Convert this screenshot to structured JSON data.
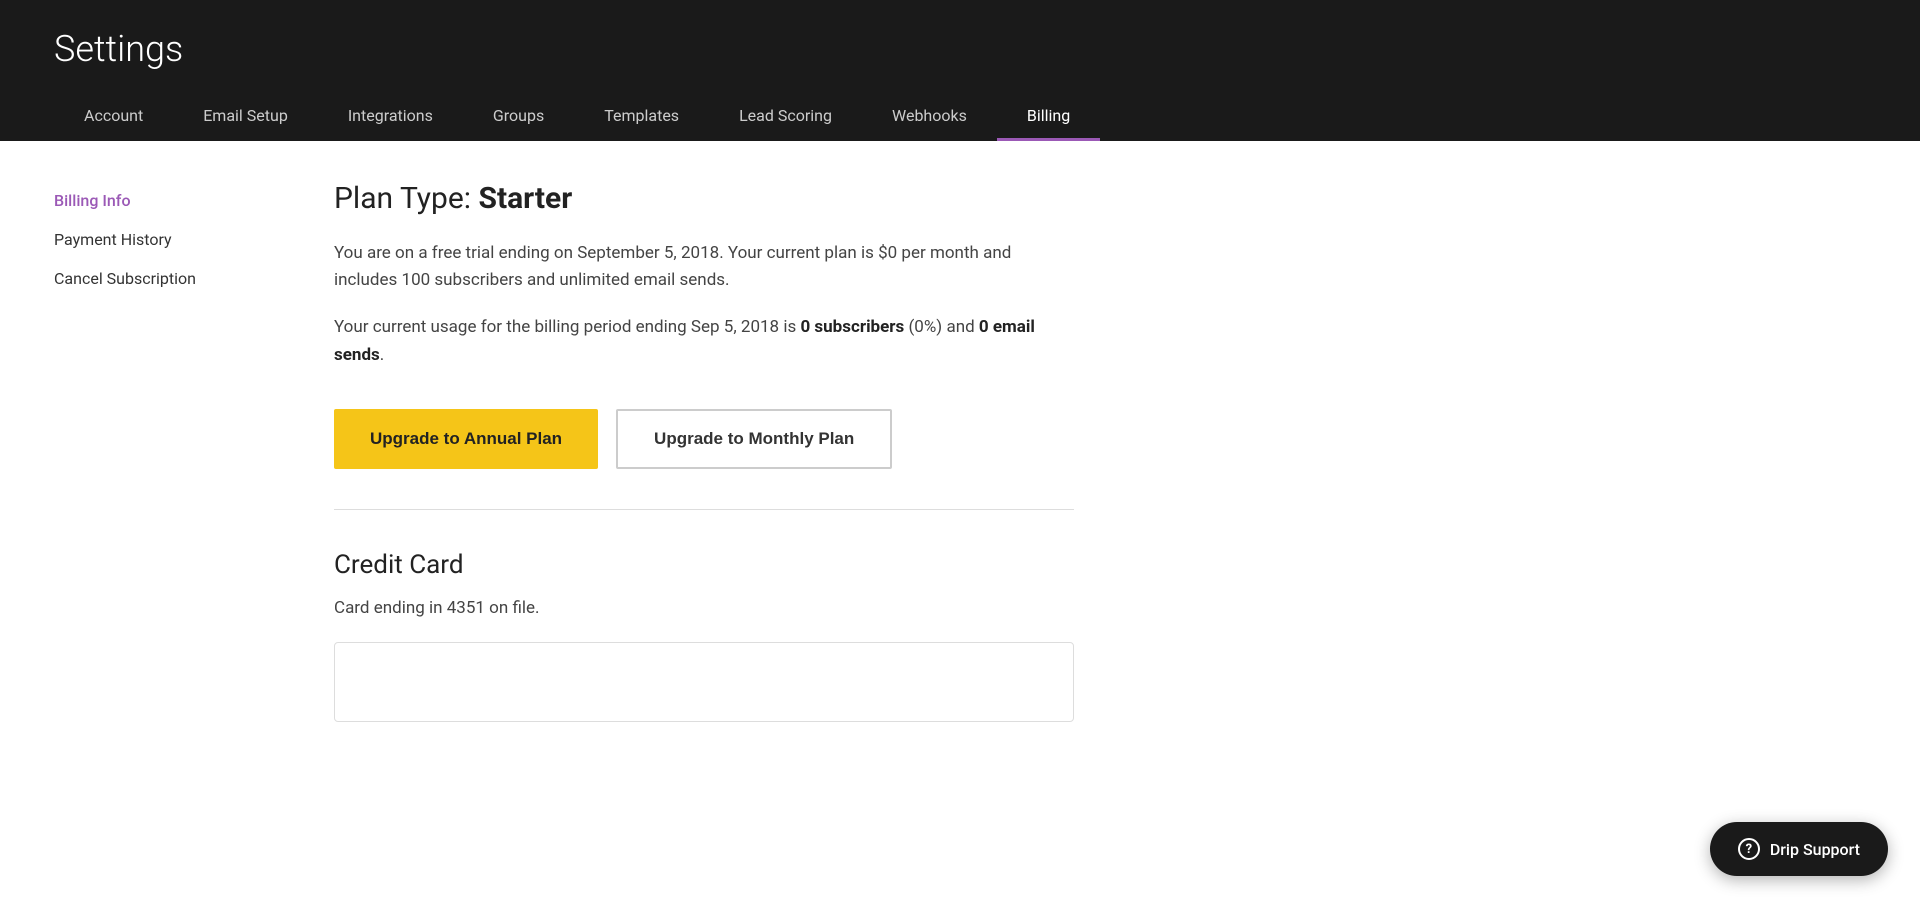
{
  "page": {
    "title": "Settings"
  },
  "nav": {
    "tabs": [
      {
        "id": "account",
        "label": "Account",
        "active": false
      },
      {
        "id": "email-setup",
        "label": "Email Setup",
        "active": false
      },
      {
        "id": "integrations",
        "label": "Integrations",
        "active": false
      },
      {
        "id": "groups",
        "label": "Groups",
        "active": false
      },
      {
        "id": "templates",
        "label": "Templates",
        "active": false
      },
      {
        "id": "lead-scoring",
        "label": "Lead Scoring",
        "active": false
      },
      {
        "id": "webhooks",
        "label": "Webhooks",
        "active": false
      },
      {
        "id": "billing",
        "label": "Billing",
        "active": true
      }
    ]
  },
  "sidebar": {
    "items": [
      {
        "id": "billing-info",
        "label": "Billing Info",
        "active": true
      },
      {
        "id": "payment-history",
        "label": "Payment History",
        "active": false
      },
      {
        "id": "cancel-subscription",
        "label": "Cancel Subscription",
        "active": false
      }
    ]
  },
  "content": {
    "plan_type_prefix": "Plan Type: ",
    "plan_type_name": "Starter",
    "plan_description": "You are on a free trial ending on September 5, 2018. Your current plan is $0 per month and includes 100 subscribers and unlimited email sends.",
    "usage_prefix": "Your current usage for the billing period ending Sep 5, 2018 is ",
    "usage_subscribers": "0 subscribers",
    "usage_percent": "(0%)",
    "usage_middle": " and ",
    "usage_sends": "0 email sends",
    "usage_suffix": ".",
    "btn_annual": "Upgrade to Annual Plan",
    "btn_monthly": "Upgrade to Monthly Plan",
    "credit_card_title": "Credit Card",
    "credit_card_desc": "Card ending in 4351 on file."
  },
  "support": {
    "label": "Drip Support",
    "icon": "?"
  }
}
